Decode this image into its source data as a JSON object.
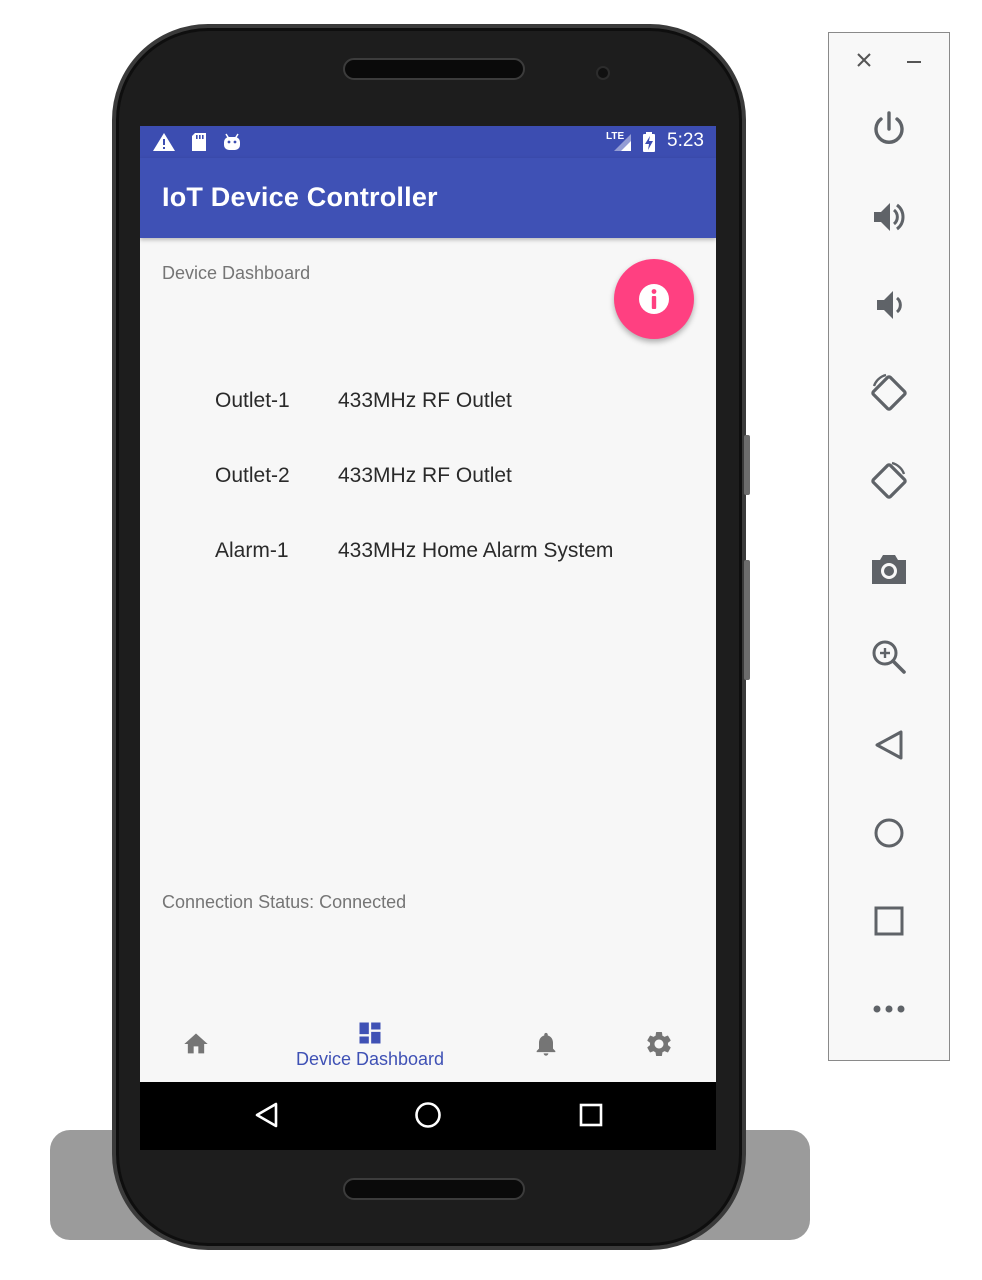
{
  "status_bar": {
    "time": "5:23",
    "network_label": "LTE",
    "icons": [
      "warning-icon",
      "sd-card-icon",
      "android-icon",
      "lte-signal-icon",
      "battery-charging-icon"
    ]
  },
  "app_bar": {
    "title": "IoT Device Controller"
  },
  "main": {
    "section_label": "Device Dashboard",
    "fab_icon": "info-icon",
    "devices": [
      {
        "name": "Outlet-1",
        "description": "433MHz RF Outlet"
      },
      {
        "name": "Outlet-2",
        "description": "433MHz RF Outlet"
      },
      {
        "name": "Alarm-1",
        "description": "433MHz Home Alarm System"
      }
    ],
    "connection_status": "Connection Status: Connected"
  },
  "bottom_nav": {
    "items": [
      {
        "icon": "home-icon",
        "label": ""
      },
      {
        "icon": "dashboard-icon",
        "label": "Device Dashboard",
        "selected": true
      },
      {
        "icon": "bell-icon",
        "label": ""
      },
      {
        "icon": "gear-icon",
        "label": ""
      }
    ]
  },
  "system_nav": [
    "back-icon",
    "home-circle-icon",
    "recents-icon"
  ],
  "emulator_toolbar": {
    "window_controls": [
      "close-icon",
      "minimize-icon"
    ],
    "buttons": [
      "power-icon",
      "volume-up-icon",
      "volume-down-icon",
      "rotate-left-icon",
      "rotate-right-icon",
      "camera-icon",
      "zoom-icon",
      "back-icon",
      "home-icon",
      "overview-icon",
      "more-icon"
    ]
  },
  "colors": {
    "primary": "#3f51b5",
    "status_bar": "#3c4db1",
    "accent": "#ff4081",
    "background": "#f7f7f7",
    "secondary_text": "#757575"
  }
}
